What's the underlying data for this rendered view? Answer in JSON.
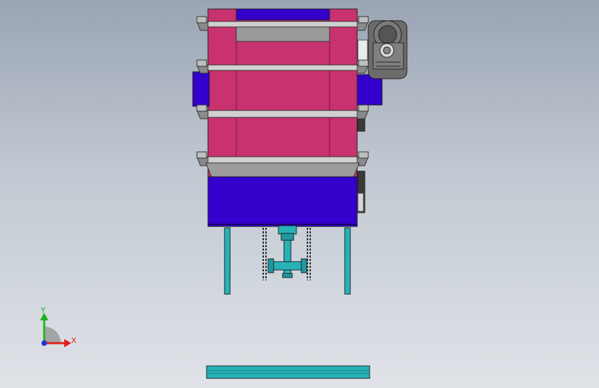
{
  "viewport": {
    "background_top": "#9aa4b4",
    "background_bottom": "#dfe3e8"
  },
  "model": {
    "tank_color": "#c8326e",
    "base_color": "#3300cc",
    "frame_color": "#7f7f7f",
    "pipe_color": "#26b3b8",
    "motor_color": "#6c6c6c"
  },
  "triad": {
    "x_label": "X",
    "y_label": "Y",
    "x_color": "#e0201c",
    "y_color": "#1fb31f",
    "z_color": "#2233dd"
  }
}
